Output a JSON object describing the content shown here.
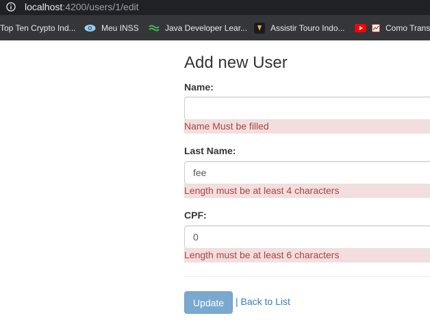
{
  "browser": {
    "url_host": "localhost",
    "url_path": ":4200/users/1/edit",
    "bookmarks": [
      {
        "label": "Top Ten Crypto Ind...",
        "icon": "none"
      },
      {
        "label": "Meu INSS",
        "icon": "inss-icon"
      },
      {
        "label": "Java Developer Lear...",
        "icon": "java-icon"
      },
      {
        "label": "Assistir Touro Indo...",
        "icon": "bull-icon"
      },
      {
        "label": "",
        "icon": "youtube-icon"
      },
      {
        "label": "Como Transf",
        "icon": "bookmark-page-icon"
      }
    ]
  },
  "form": {
    "title": "Add new User",
    "name_label": "Name:",
    "name_value": "",
    "name_error": "Name Must be filled",
    "lastname_label": "Last Name:",
    "lastname_value": "fee",
    "lastname_error": "Length must be at least 4 characters",
    "cpf_label": "CPF:",
    "cpf_value": "0",
    "cpf_error": "Length must be at least 6 characters",
    "update_label": "Update",
    "back_label": "| Back to List"
  },
  "colors": {
    "error_bg": "#f2dede",
    "error_text": "#a94442",
    "primary": "#337ab7",
    "chrome_dark": "#202124",
    "bookmarks_bar": "#35363a"
  }
}
